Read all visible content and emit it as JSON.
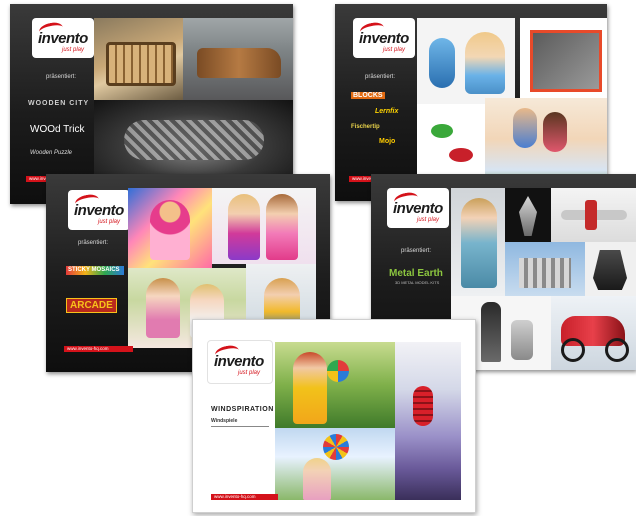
{
  "logo": {
    "word": "invento",
    "tagline": "just play"
  },
  "presents_label": "präsentiert:",
  "url_text": "www.invento-hq.com",
  "cards": {
    "card1": {
      "brands": [
        "WOODEN CITY",
        "WOOd Trick",
        "Wooden Puzzle"
      ]
    },
    "card2": {
      "brands": [
        "BLOCKS",
        "Lernfix",
        "Fischertip",
        "Mojo"
      ]
    },
    "card3": {
      "brands": [
        "STICKY MOSAICS",
        "ARCADE"
      ]
    },
    "card4": {
      "brands": [
        "Metal Earth"
      ],
      "brand_sub": "3D METAL MODEL KITS"
    },
    "card5": {
      "brands": [
        "WINDSPIRATION"
      ],
      "brand_sub": "Windspiele"
    }
  },
  "colors": {
    "brand_red": "#d4121a",
    "card_dark": "#1c1c1c",
    "metal_earth_green": "#8cc63f"
  }
}
